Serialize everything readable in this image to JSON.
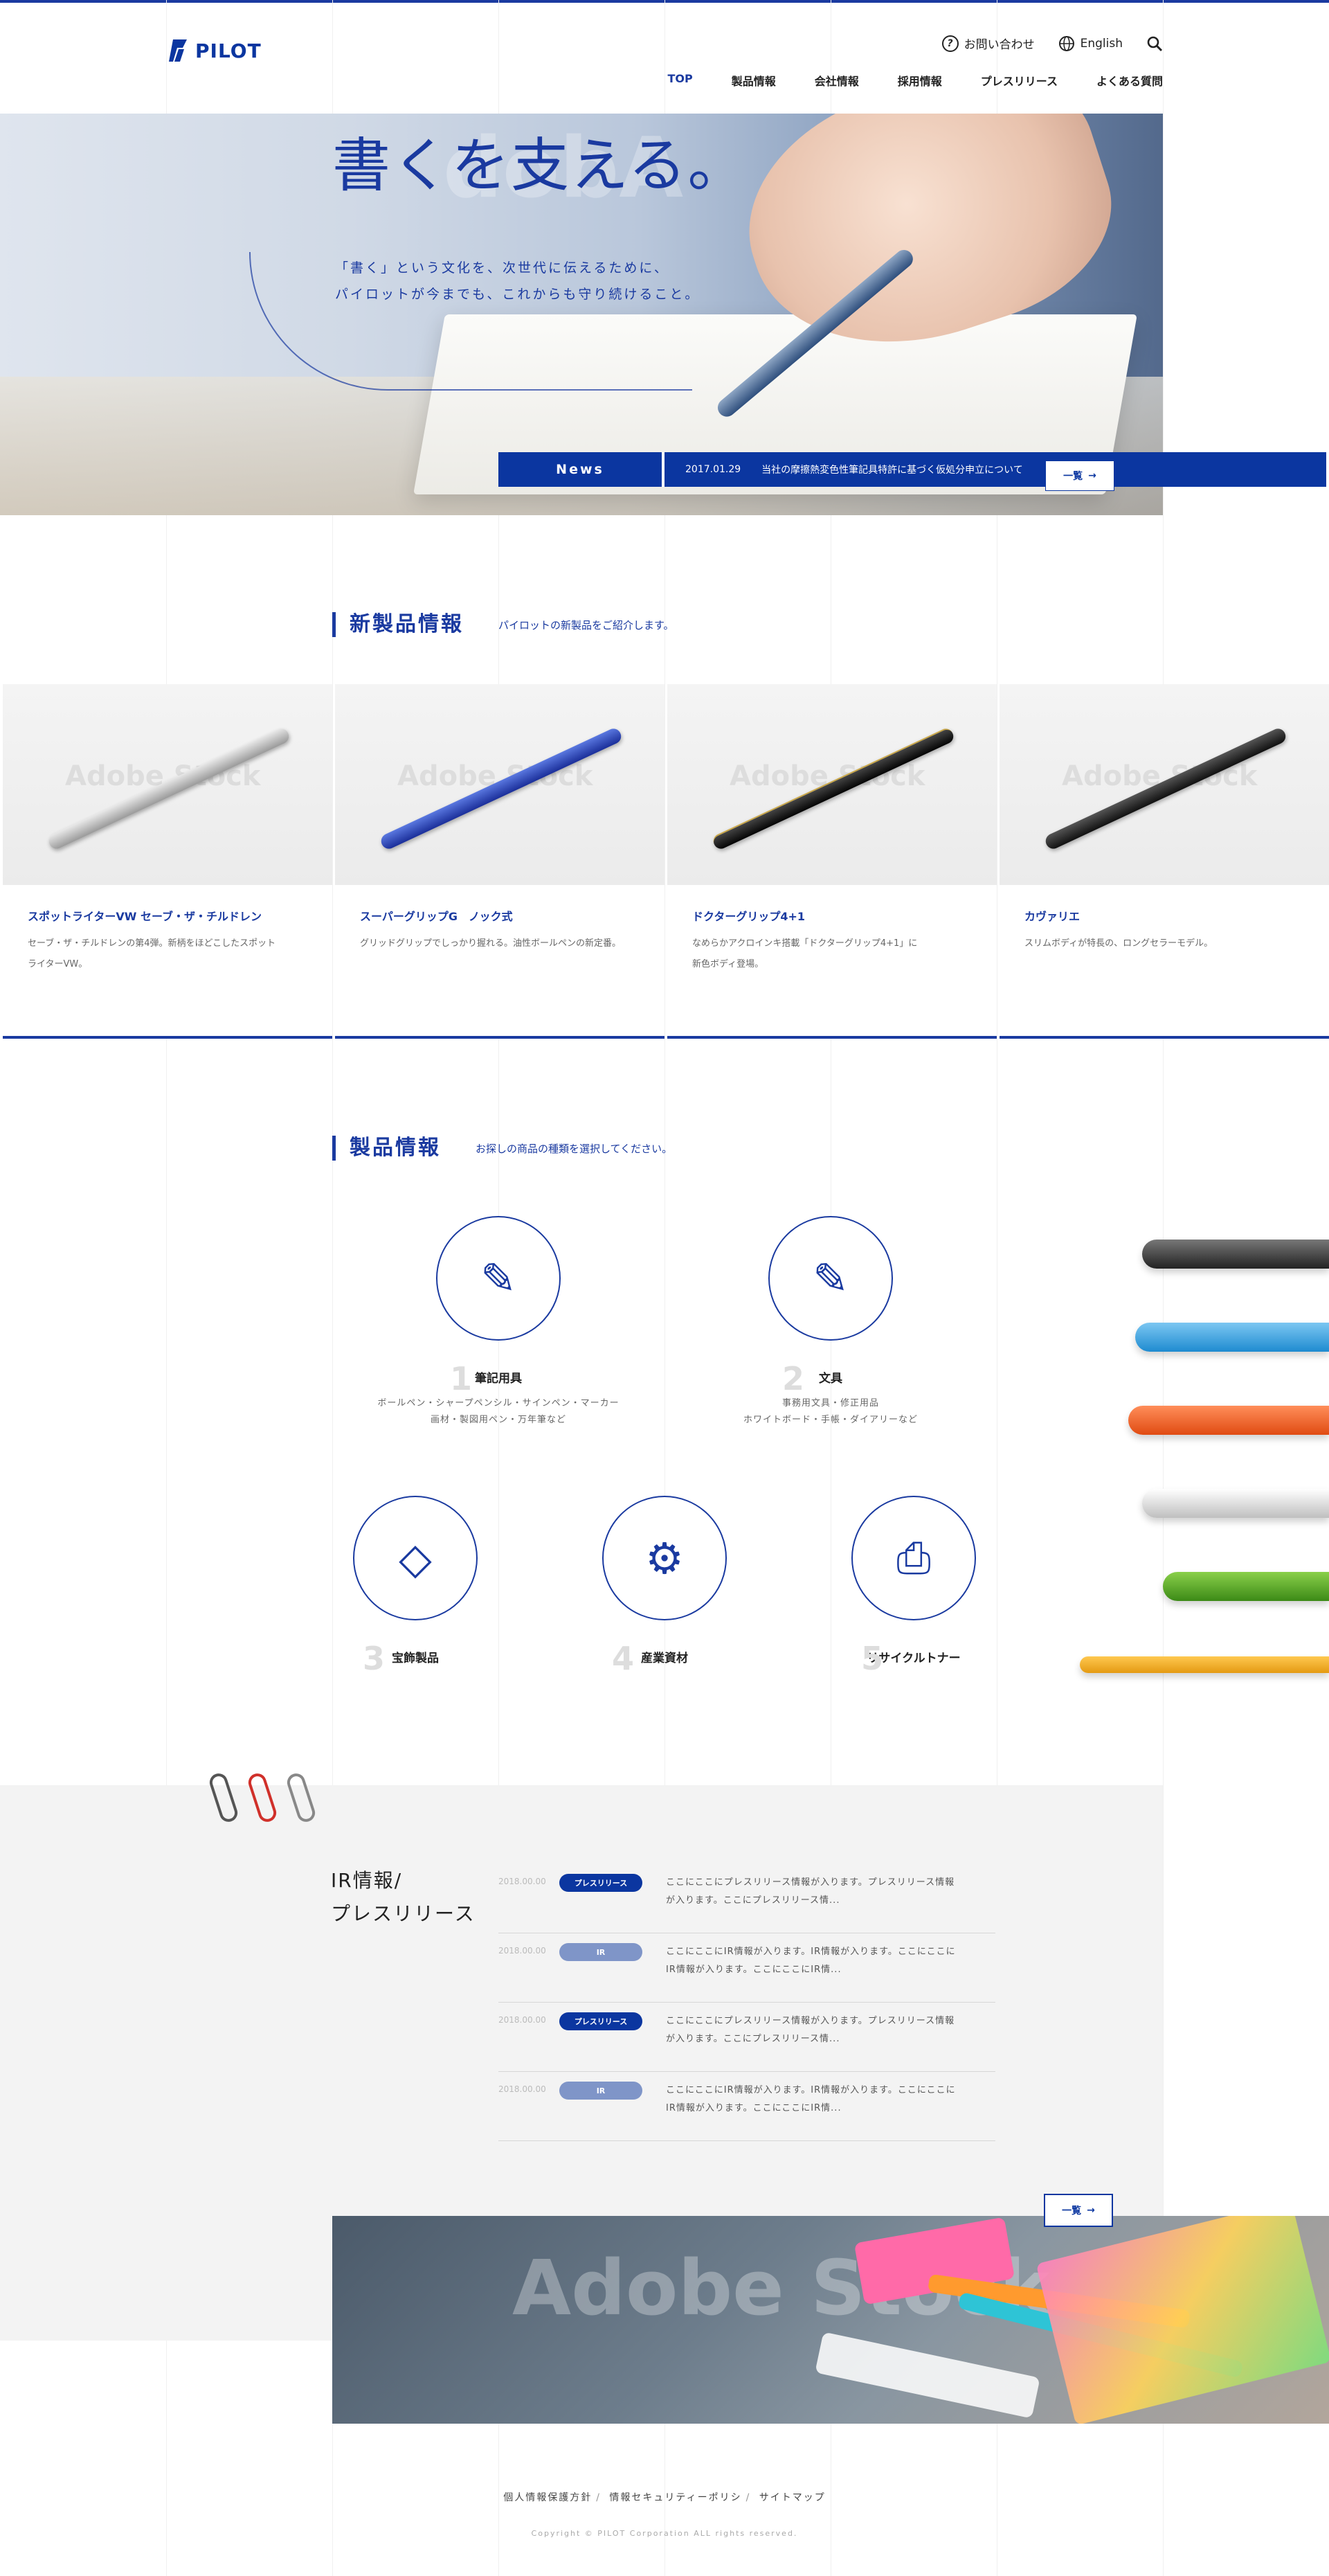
{
  "brand": {
    "logo_text": "PILOT",
    "accent": "#1a3aa0"
  },
  "utility": {
    "contact": "お問い合わせ",
    "english": "English"
  },
  "nav": [
    "TOP",
    "製品情報",
    "会社情報",
    "採用情報",
    "プレスリリース",
    "よくある質問"
  ],
  "hero": {
    "title": "書くを支える。",
    "sub_line1": "「書く」という文化を、次世代に伝えるために、",
    "sub_line2": "パイロットが今までも、これからも守り続けること。",
    "watermark": "dobA"
  },
  "news": {
    "label": "News",
    "date": "2017.01.29",
    "text": "当社の摩擦熱変色性筆記具特許に基づく仮処分申立について",
    "more": "一覧"
  },
  "new_products": {
    "title": "新製品情報",
    "subtitle": "パイロットの新製品をご紹介します。",
    "items": [
      {
        "name": "スポットライターVW セーブ・ザ・チルドレン",
        "desc1": "セーブ・ザ・チルドレンの第4弾。新柄をほどこしたスポット",
        "desc2": "ライターVW。"
      },
      {
        "name": "スーパーグリップG　ノック式",
        "desc1": "グリッドグリップでしっかり握れる。油性ボールペンの新定番。",
        "desc2": ""
      },
      {
        "name": "ドクターグリップ4+1",
        "desc1": "なめらかアクロインキ搭載「ドクターグリップ4+1」に",
        "desc2": "新色ボディ登場。"
      },
      {
        "name": "カヴァリエ",
        "desc1": "スリムボディが特長の、ロングセラーモデル。",
        "desc2": ""
      }
    ]
  },
  "products": {
    "title": "製品情報",
    "subtitle": "お探しの商品の種類を選択してください。",
    "categories": [
      {
        "num": "1",
        "label": "筆記用具",
        "sub1": "ボールペン・シャープペンシル・サインペン・マーカー",
        "sub2": "画材・製図用ペン・万年筆など",
        "icon": "pencil-icon"
      },
      {
        "num": "2",
        "label": "文具",
        "sub1": "事務用文具・修正用品",
        "sub2": "ホワイトボード・手帳・ダイアリーなど",
        "icon": "pencil-icon"
      },
      {
        "num": "3",
        "label": "宝飾製品",
        "icon": "diamond-icon"
      },
      {
        "num": "4",
        "label": "産業資材",
        "icon": "machine-icon"
      },
      {
        "num": "5",
        "label": "リサイクルトナー",
        "icon": "printer-icon"
      }
    ]
  },
  "ir": {
    "title_line1": "IR情報/",
    "title_line2": "プレスリリース",
    "rows": [
      {
        "date": "2018.00.00",
        "tag": "プレスリリース",
        "tag_color": "#0b36a0",
        "text": "ここにここにプレスリリース情報が入ります。プレスリリース情報が入ります。ここにプレスリリース情..."
      },
      {
        "date": "2018.00.00",
        "tag": "IR",
        "tag_color": "#7f95c8",
        "text": "ここにここにIR情報が入ります。IR情報が入ります。ここにここにIR情報が入ります。ここにここにIR情..."
      },
      {
        "date": "2018.00.00",
        "tag": "プレスリリース",
        "tag_color": "#0b36a0",
        "text": "ここにここにプレスリリース情報が入ります。プレスリリース情報が入ります。ここにプレスリリース情..."
      },
      {
        "date": "2018.00.00",
        "tag": "IR",
        "tag_color": "#7f95c8",
        "text": "ここにここにIR情報が入ります。IR情報が入ります。ここにここにIR情報が入ります。ここにここにIR情..."
      }
    ],
    "more": "一覧",
    "photo_watermark": "Adobe Stock"
  },
  "footer": {
    "privacy": "個人情報保護方針",
    "security": "情報セキュリティーポリシ",
    "sitemap": "サイトマップ",
    "copyright": "Copyright © PILOT Corporation ALL rights reserved."
  }
}
